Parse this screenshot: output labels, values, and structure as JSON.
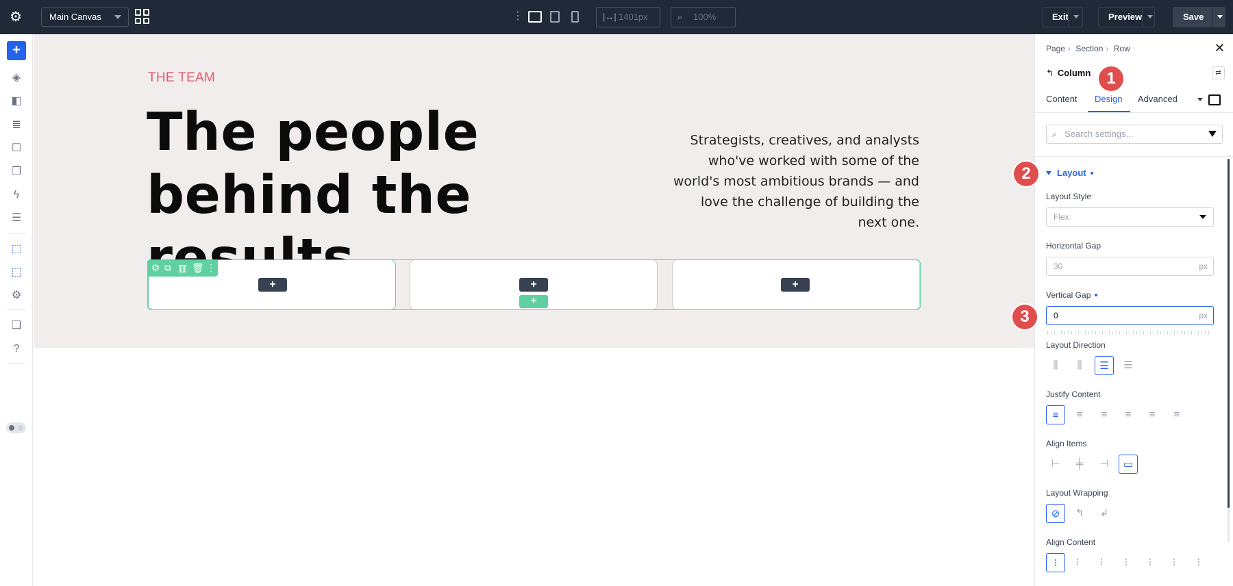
{
  "topbar": {
    "canvas_select": "Main Canvas",
    "width_value": "1401px",
    "zoom_value": "100%",
    "exit_label": "Exit",
    "preview_label": "Preview",
    "save_label": "Save"
  },
  "canvas": {
    "eyebrow": "THE TEAM",
    "headline": "The people behind the results.",
    "blurb": "Strategists, creatives, and analysts who've worked with some of the world's most ambitious brands — and love the challenge of building the next one.",
    "add_symbol": "+"
  },
  "panel": {
    "breadcrumb": [
      "Page",
      "Section",
      "Row"
    ],
    "column_title": "Column",
    "tabs": [
      "Content",
      "Design",
      "Advanced"
    ],
    "active_tab": "Design",
    "search_placeholder": "Search settings...",
    "section_title": "Layout",
    "layout_style_label": "Layout Style",
    "layout_style_value": "Flex",
    "horizontal_gap_label": "Horizontal Gap",
    "horizontal_gap_placeholder": "30",
    "vertical_gap_label": "Vertical Gap",
    "vertical_gap_value": "0",
    "unit": "px",
    "layout_direction_label": "Layout Direction",
    "justify_content_label": "Justify Content",
    "align_items_label": "Align Items",
    "layout_wrapping_label": "Layout Wrapping",
    "align_content_label": "Align Content"
  },
  "callouts": [
    "1",
    "2",
    "3"
  ],
  "colors": {
    "accent": "#2563eb",
    "callout": "#df4d4d",
    "eyebrow": "#e2586b",
    "row_outline": "#5fd0a0",
    "stage_bg": "#f1eded"
  }
}
